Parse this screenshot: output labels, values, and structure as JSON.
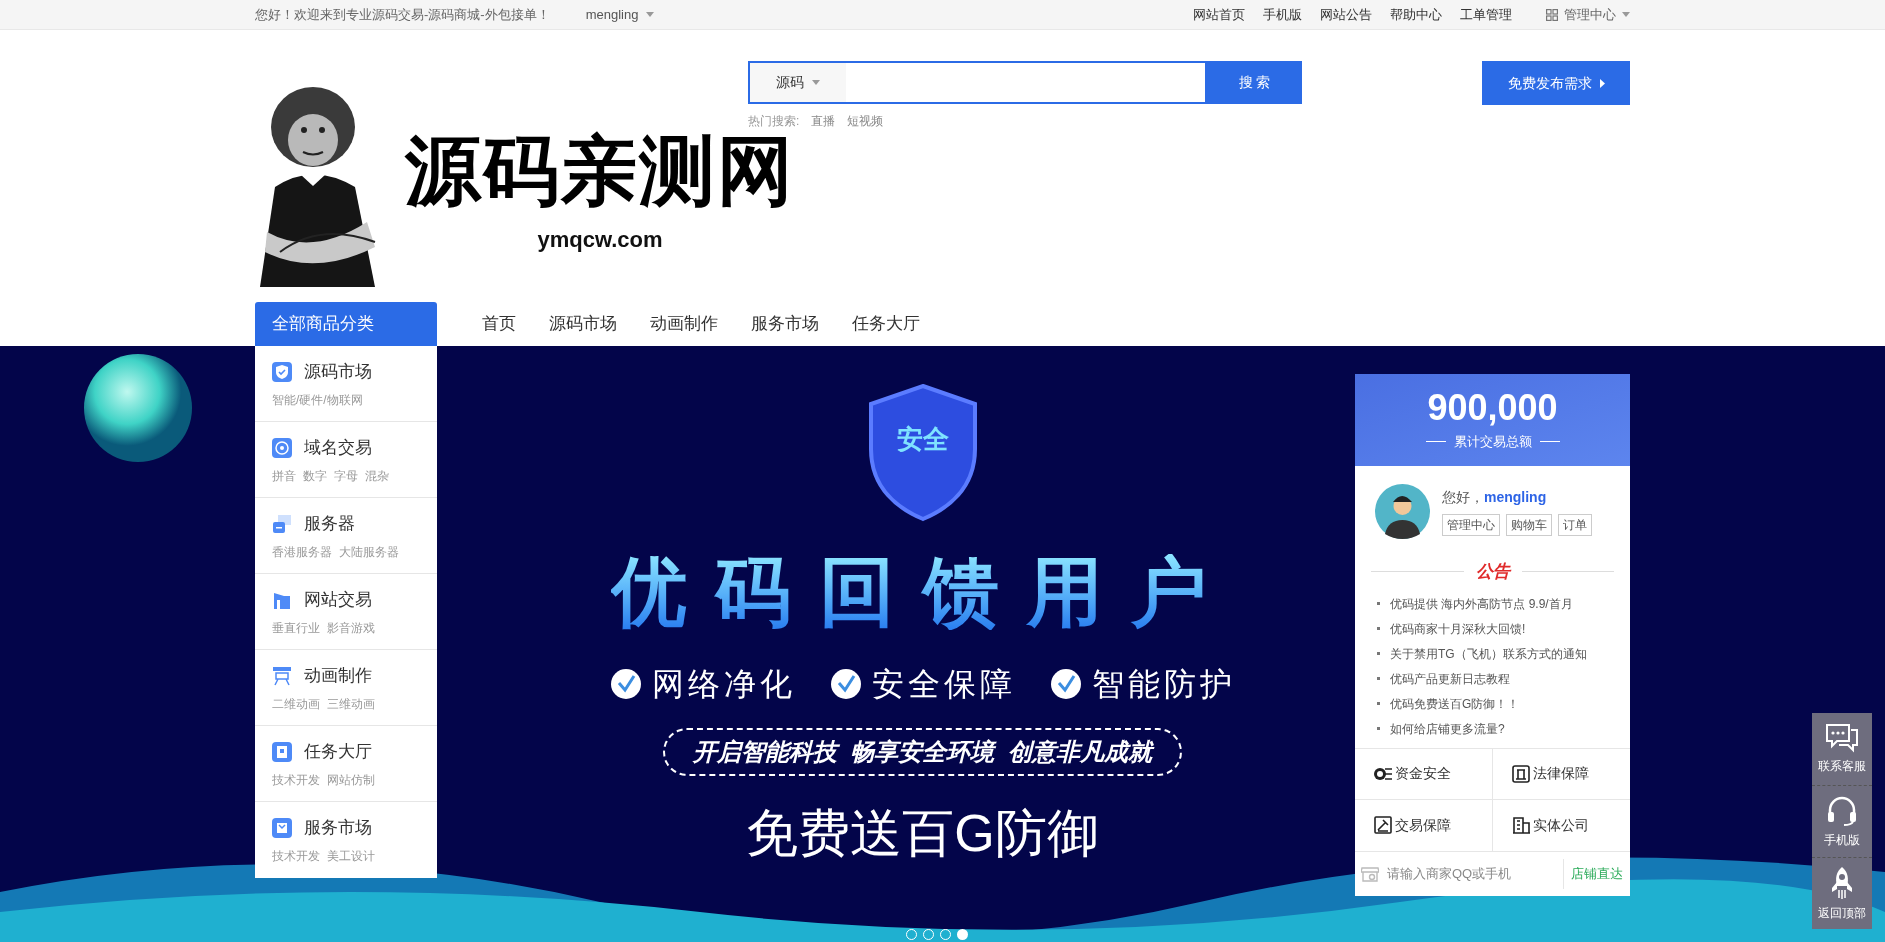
{
  "top_bar": {
    "greeting": "您好！欢迎来到专业源码交易-源码商城-外包接单！",
    "user": "mengling",
    "links": [
      "网站首页",
      "手机版",
      "网站公告",
      "帮助中心",
      "工单管理"
    ],
    "admin": "管理中心"
  },
  "header": {
    "logo": {
      "title": "源码亲测网",
      "domain": "ymqcw.com"
    },
    "search": {
      "category": "源码",
      "button": "搜 索"
    },
    "hot_search": {
      "label": "热门搜索:",
      "terms": [
        "直播",
        "短视频"
      ]
    },
    "publish_button": "免费发布需求"
  },
  "nav": {
    "category_header": "全部商品分类",
    "items": [
      "首页",
      "源码市场",
      "动画制作",
      "服务市场",
      "任务大厅"
    ]
  },
  "categories": [
    {
      "title": "源码市场",
      "tags": [
        "智能/硬件/物联网"
      ]
    },
    {
      "title": "域名交易",
      "tags": [
        "拼音",
        "数字",
        "字母",
        "混杂"
      ]
    },
    {
      "title": "服务器",
      "tags": [
        "香港服务器",
        "大陆服务器"
      ]
    },
    {
      "title": "网站交易",
      "tags": [
        "垂直行业",
        "影音游戏"
      ]
    },
    {
      "title": "动画制作",
      "tags": [
        "二维动画",
        "三维动画"
      ]
    },
    {
      "title": "任务大厅",
      "tags": [
        "技术开发",
        "网站仿制"
      ]
    },
    {
      "title": "服务市场",
      "tags": [
        "技术开发",
        "美工设计"
      ]
    }
  ],
  "banner": {
    "shield_text": "安全",
    "headline": "优码回馈用户",
    "features": [
      "网络净化",
      "安全保障",
      "智能防护"
    ],
    "slogan": "开启智能科技  畅享安全环境  创意非凡成就",
    "offer": "免费送百G防御",
    "dots": [
      {
        "selected": false
      },
      {
        "selected": false
      },
      {
        "selected": false
      },
      {
        "selected": true
      }
    ]
  },
  "panel": {
    "stat": {
      "value": "900,000",
      "caption": "累计交易总额"
    },
    "user": {
      "greeting": "您好，",
      "name": "mengling",
      "buttons": [
        "管理中心",
        "购物车",
        "订单"
      ]
    },
    "notice_title": "公告",
    "notices": [
      "优码提供 海内外高防节点 9.9/首月",
      "优码商家十月深秋大回馈!",
      "关于禁用TG（飞机）联系方式的通知",
      "优码产品更新日志教程",
      "优码免费送百G防御！！",
      "如何给店铺更多流量?"
    ],
    "guarantees": [
      "资金安全",
      "法律保障",
      "交易保障",
      "实体公司"
    ],
    "shop_search": {
      "placeholder": "请输入商家QQ或手机",
      "button": "店铺直达"
    }
  },
  "float_tools": [
    "联系客服",
    "手机版",
    "返回顶部"
  ]
}
